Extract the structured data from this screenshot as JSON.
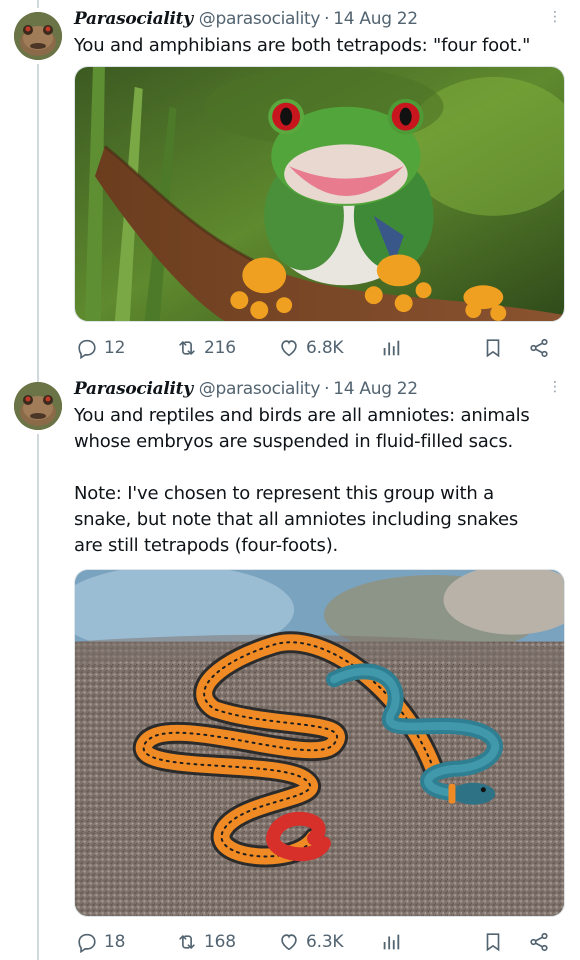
{
  "tweets": [
    {
      "display_name": "Parasociality",
      "handle": "@parasociality",
      "separator": "·",
      "date": "14 Aug 22",
      "text": "You and amphibians are both tetrapods: \"four foot.\"",
      "media_subject": "red-eyed tree frog on a branch",
      "replies": "12",
      "retweets": "216",
      "likes": "6.8K",
      "more_icon": "more-vertical-icon"
    },
    {
      "display_name": "Parasociality",
      "handle": "@parasociality",
      "separator": "·",
      "date": "14 Aug 22",
      "text": "You and reptiles and birds are all amniotes: animals\nwhose embryos are suspended in fluid-filled sacs.\n\nNote: I've chosen to represent this group with a\nsnake, but note that all amniotes including snakes\nare still tetrapods (four-foots).",
      "media_subject": "ring-necked snake coiled on a rock",
      "replies": "18",
      "retweets": "168",
      "likes": "6.3K",
      "more_icon": "more-vertical-icon"
    }
  ],
  "colors": {
    "text": "#0f1419",
    "secondary": "#536471",
    "thread_line": "#cfd9de"
  }
}
